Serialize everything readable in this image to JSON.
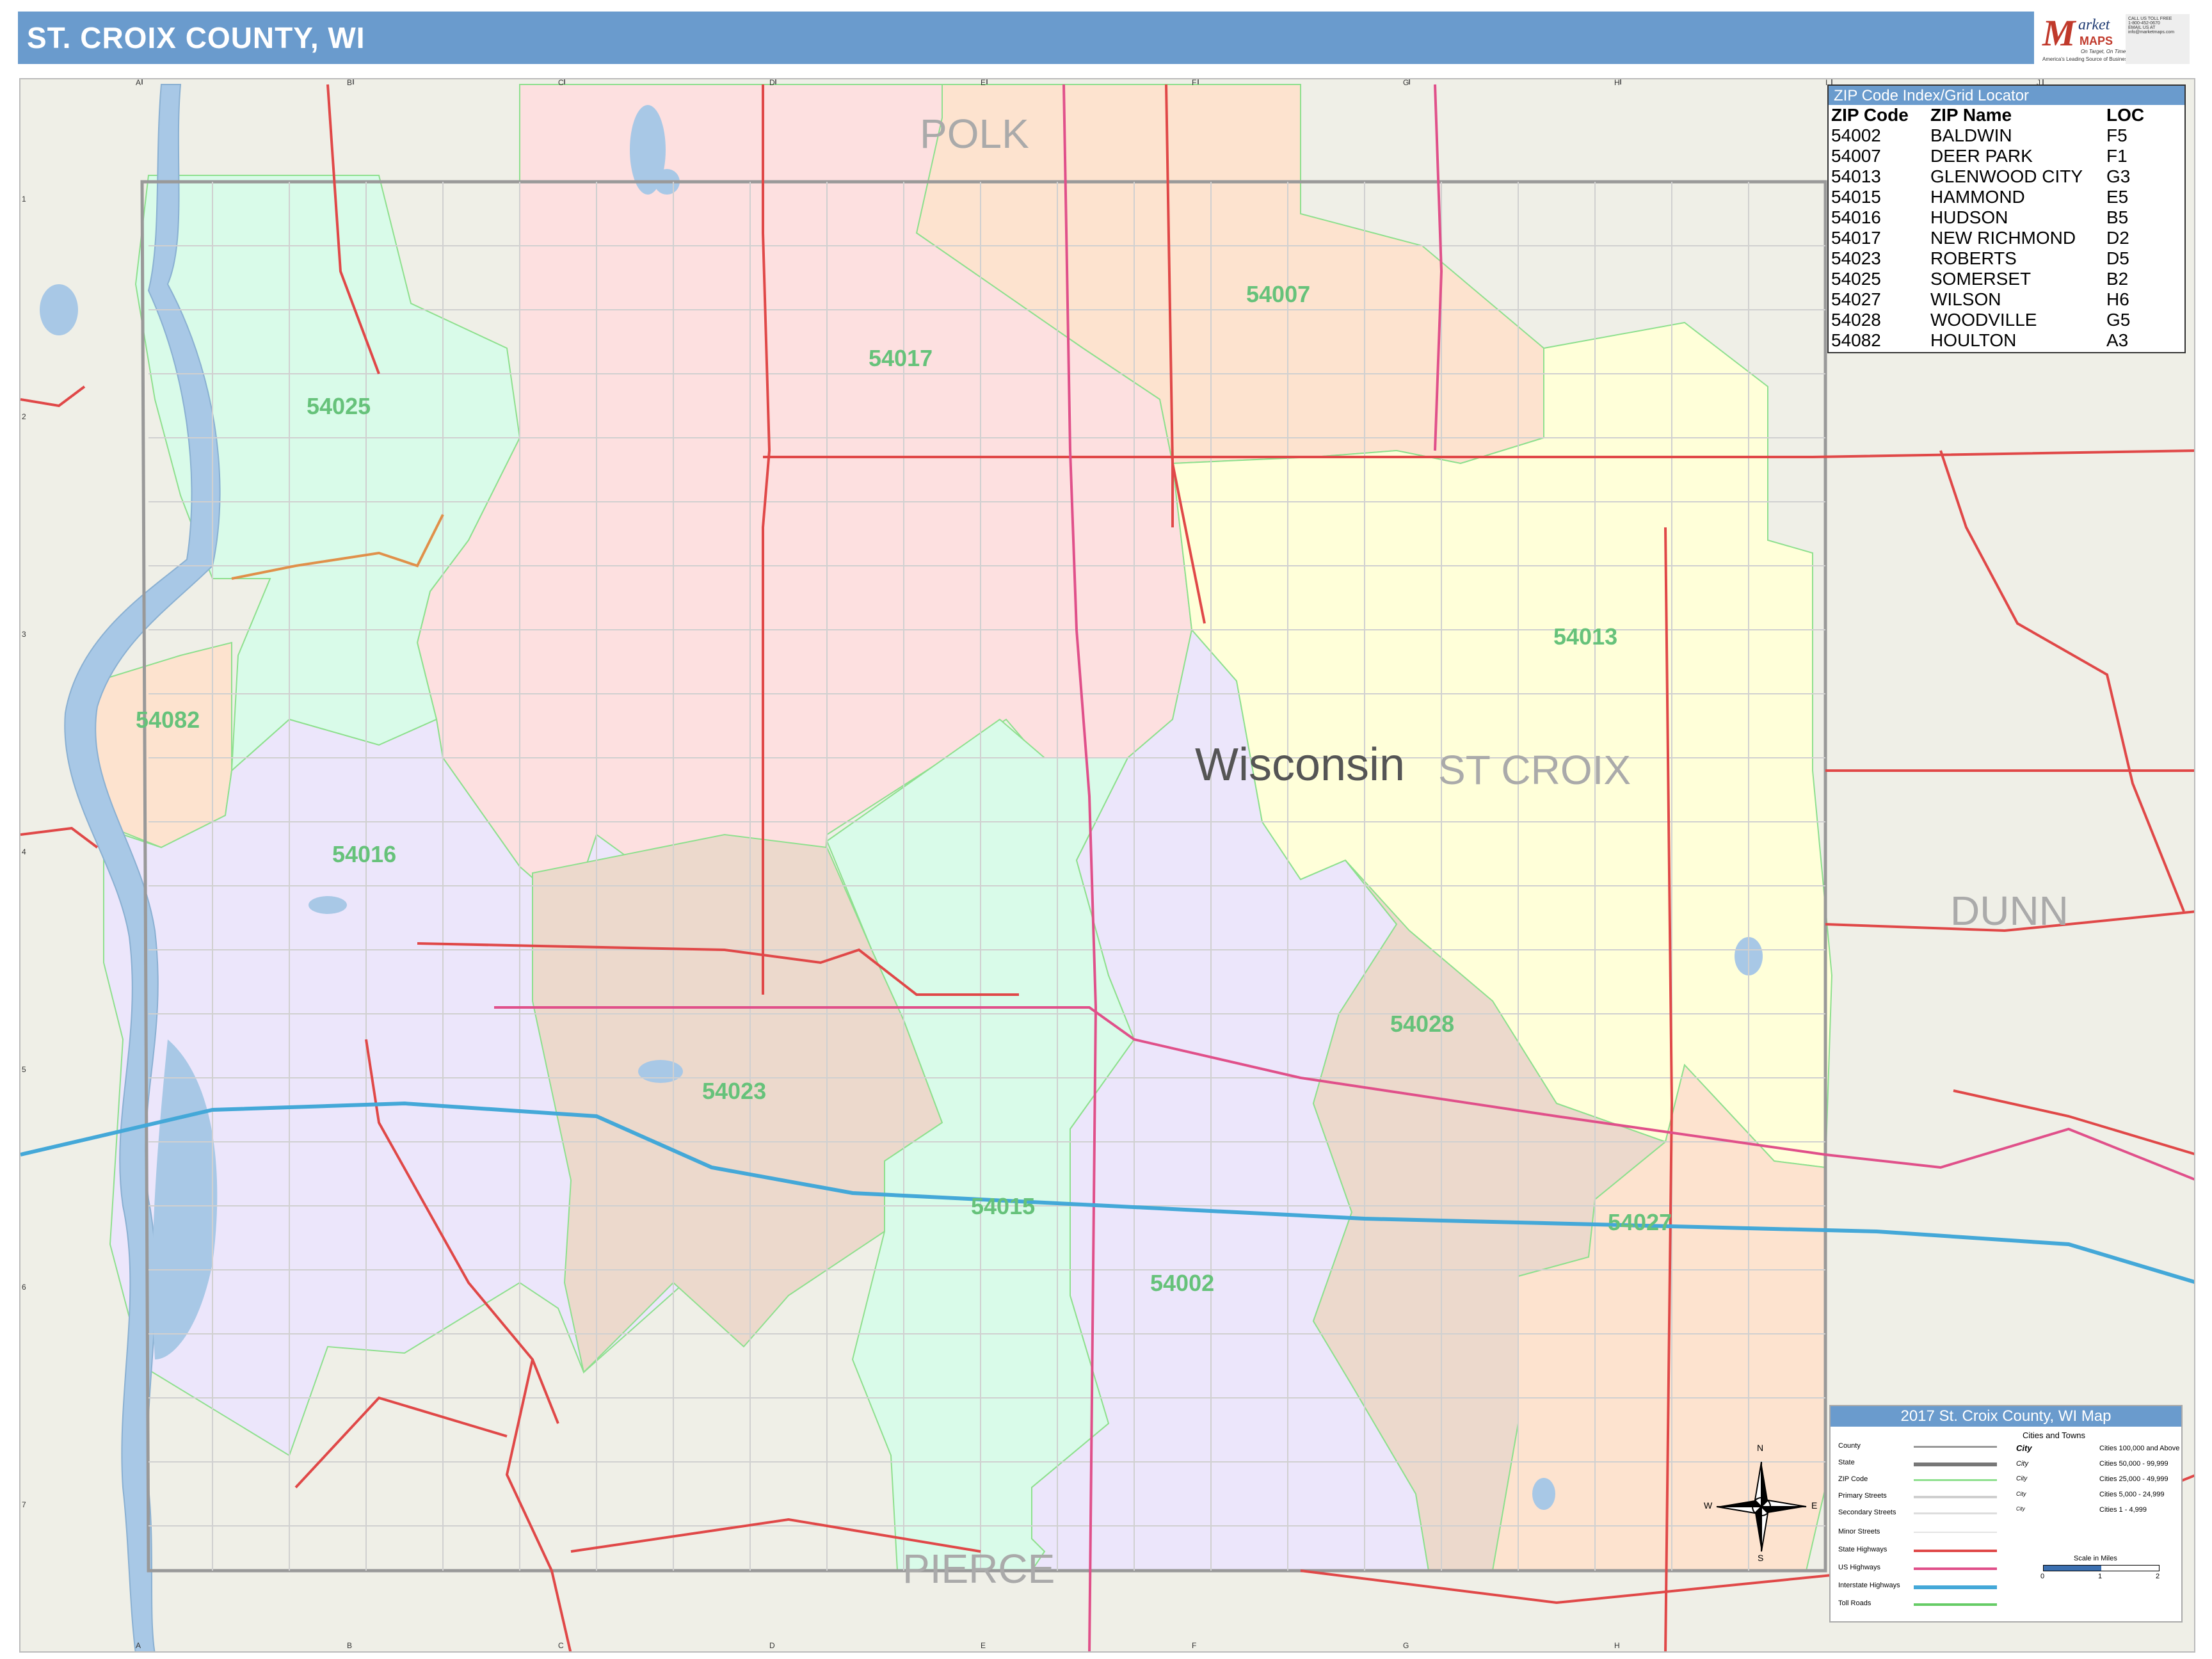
{
  "header": {
    "title": "ST. CROIX COUNTY, WI"
  },
  "brand": {
    "logo_m": "M",
    "logo_arket": "arket",
    "logo_maps": "MAPS",
    "tagline": "On Target, On Time",
    "sub_tagline": "America's Leading Source of Business Maps",
    "contact_lines": [
      "CALL US TOLL FREE",
      "1-800-452-0670",
      "EMAIL US AT",
      "info@marketmaps.com"
    ]
  },
  "zip_index": {
    "title": "ZIP Code Index/Grid Locator",
    "columns": [
      "ZIP Code",
      "ZIP Name",
      "LOC"
    ],
    "rows": [
      [
        "54002",
        "BALDWIN",
        "F5"
      ],
      [
        "54007",
        "DEER PARK",
        "F1"
      ],
      [
        "54013",
        "GLENWOOD CITY",
        "G3"
      ],
      [
        "54015",
        "HAMMOND",
        "E5"
      ],
      [
        "54016",
        "HUDSON",
        "B5"
      ],
      [
        "54017",
        "NEW RICHMOND",
        "D2"
      ],
      [
        "54023",
        "ROBERTS",
        "D5"
      ],
      [
        "54025",
        "SOMERSET",
        "B2"
      ],
      [
        "54027",
        "WILSON",
        "H6"
      ],
      [
        "54028",
        "WOODVILLE",
        "G5"
      ],
      [
        "54082",
        "HOULTON",
        "A3"
      ]
    ]
  },
  "map": {
    "county_labels": [
      "POLK",
      "ST CROIX",
      "DUNN",
      "PIERCE"
    ],
    "state_label": "Wisconsin",
    "zip_labels": [
      "54025",
      "54017",
      "54007",
      "54013",
      "54082",
      "54016",
      "54028",
      "54023",
      "54015",
      "54002",
      "54027"
    ],
    "grid_letters": [
      "A",
      "B",
      "C",
      "D",
      "E",
      "F",
      "G",
      "H",
      "I",
      "J"
    ],
    "grid_numbers": [
      "1",
      "2",
      "3",
      "4",
      "5",
      "6",
      "7"
    ],
    "colors": {
      "background": "#efefe7",
      "water": "#a8c8e6",
      "pink": "#fde0e0",
      "mint": "#d9fbe9",
      "peach": "#fde3cf",
      "yellow": "#ffffd9",
      "lavender": "#ece6fb",
      "tan": "#ecd9cc",
      "state_highway": "#e04848",
      "us_highway": "#e0508a",
      "interstate": "#44a8d8",
      "zip_border": "#8ee08e"
    }
  },
  "legend": {
    "title": "2017 St. Croix County, WI Map",
    "cities_title": "Cities and Towns",
    "items": [
      "County",
      "State",
      "ZIP Code",
      "Primary Streets",
      "Secondary Streets",
      "Minor Streets",
      "State Highways",
      "US Highways",
      "Interstate Highways",
      "Toll Roads"
    ],
    "city_samples": [
      "City",
      "City",
      "City",
      "City",
      "City"
    ],
    "city_sizes": [
      "Cities 100,000 and Above",
      "Cities 50,000 - 99,999",
      "Cities 25,000 - 49,999",
      "Cities 5,000 - 24,999",
      "Cities 1 - 4,999"
    ],
    "scale_title": "Scale in Miles",
    "scale_ticks": [
      "0",
      "1",
      "2"
    ]
  },
  "compass": {
    "n": "N",
    "s": "S",
    "e": "E",
    "w": "W"
  }
}
